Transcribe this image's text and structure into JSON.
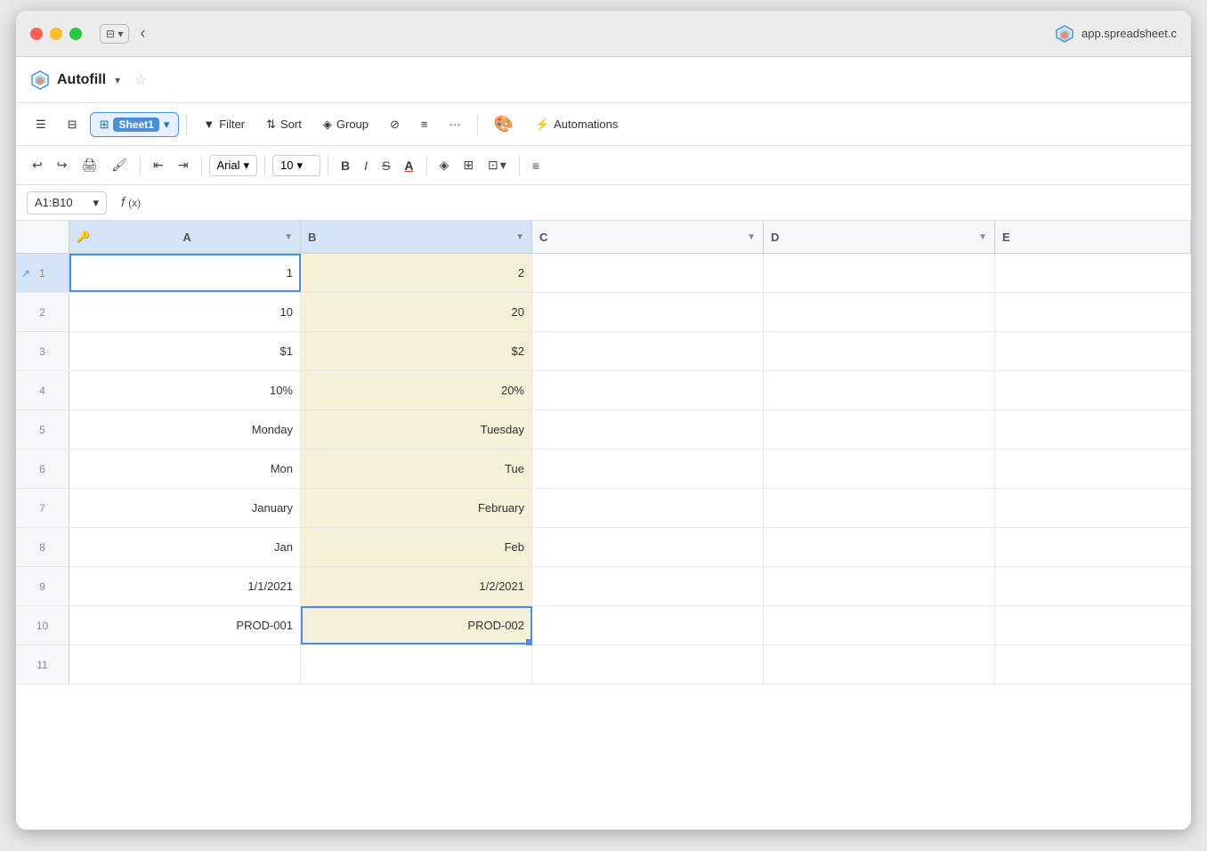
{
  "window": {
    "url": "app.spreadsheet.c"
  },
  "header": {
    "title": "Autofill",
    "star_label": "☆"
  },
  "toolbar": {
    "menu_icon": "☰",
    "sidebar_icon": "⊟",
    "sheet1_label": "Sheet1",
    "filter_label": "Filter",
    "sort_label": "Sort",
    "group_label": "Group",
    "hide_label": "",
    "rowheight_label": "",
    "more_label": "···",
    "automations_label": "Automations"
  },
  "formatbar": {
    "undo_label": "↩",
    "redo_label": "↪",
    "print_label": "🖨",
    "paint_label": "🖌",
    "indent_dec": "⇤",
    "indent_inc": "⇥",
    "font_name": "Arial",
    "font_size": "10",
    "bold_label": "B",
    "italic_label": "I",
    "strike_label": "S",
    "underline_label": "A",
    "fillcolor_label": "◈",
    "borders_label": "⊞",
    "merge_label": "⊡",
    "align_label": "≡"
  },
  "formulabar": {
    "cell_ref": "A1:B10",
    "fx_label": "f(x)"
  },
  "columns": [
    {
      "id": "A",
      "name": "A",
      "icon": "🔑",
      "selected": true
    },
    {
      "id": "B",
      "name": "B",
      "selected": true
    },
    {
      "id": "C",
      "name": "C",
      "selected": false
    },
    {
      "id": "D",
      "name": "D",
      "selected": false
    },
    {
      "id": "E",
      "name": "E",
      "selected": false
    }
  ],
  "rows": [
    {
      "num": "1",
      "a": "1",
      "b": "2",
      "c": "",
      "d": "",
      "selected": true
    },
    {
      "num": "2",
      "a": "10",
      "b": "20",
      "c": "",
      "d": "",
      "selected": false
    },
    {
      "num": "3",
      "a": "$1",
      "b": "$2",
      "c": "",
      "d": "",
      "selected": false
    },
    {
      "num": "4",
      "a": "10%",
      "b": "20%",
      "c": "",
      "d": "",
      "selected": false
    },
    {
      "num": "5",
      "a": "Monday",
      "b": "Tuesday",
      "c": "",
      "d": "",
      "selected": false
    },
    {
      "num": "6",
      "a": "Mon",
      "b": "Tue",
      "c": "",
      "d": "",
      "selected": false
    },
    {
      "num": "7",
      "a": "January",
      "b": "February",
      "c": "",
      "d": "",
      "selected": false
    },
    {
      "num": "8",
      "a": "Jan",
      "b": "Feb",
      "c": "",
      "d": "",
      "selected": false
    },
    {
      "num": "9",
      "a": "1/1/2021",
      "b": "1/2/2021",
      "c": "",
      "d": "",
      "selected": false
    },
    {
      "num": "10",
      "a": "PROD-001",
      "b": "PROD-002",
      "c": "",
      "d": "",
      "selected": false
    },
    {
      "num": "11",
      "a": "",
      "b": "",
      "c": "",
      "d": "",
      "selected": false
    }
  ]
}
